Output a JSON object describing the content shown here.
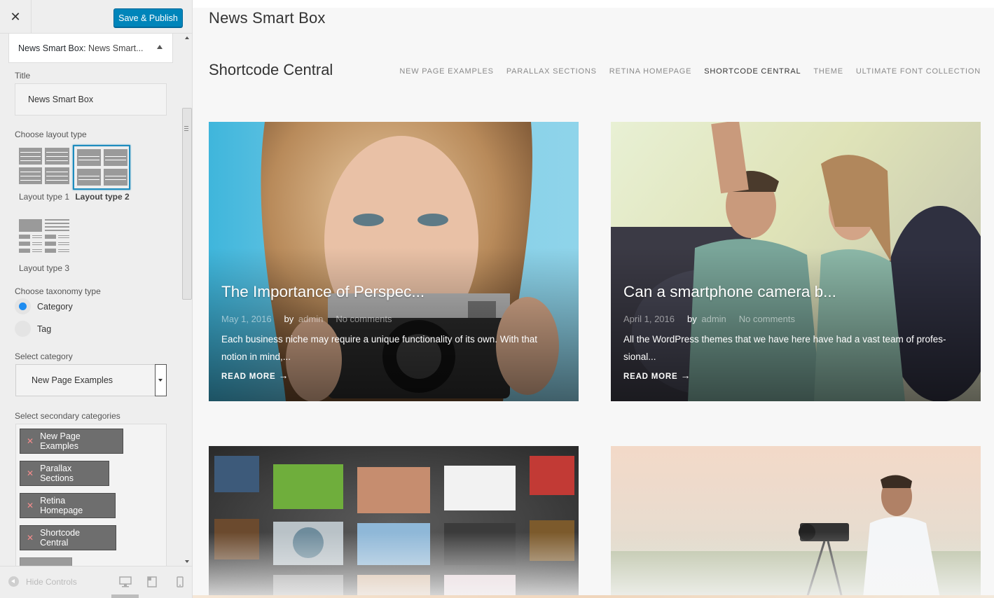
{
  "customizer": {
    "close_icon": "close-icon",
    "publish_label": "Save & Publish",
    "section_prefix": "News Smart Box:",
    "section_title": "News Smart...",
    "title_label": "Title",
    "title_value": "News Smart Box",
    "layout_label": "Choose layout type",
    "layouts": [
      {
        "label": "Layout type 1",
        "selected": false
      },
      {
        "label": "Layout type 2",
        "selected": true
      },
      {
        "label": "Layout type 3",
        "selected": false
      }
    ],
    "taxonomy_label": "Choose taxonomy type",
    "taxonomy_options": [
      {
        "label": "Category",
        "checked": true
      },
      {
        "label": "Tag",
        "checked": false
      }
    ],
    "category_label": "Select category",
    "category_value": "New Page Examples",
    "secondary_label": "Select secondary categories",
    "secondary_chips": [
      "New Page Examples",
      "Parallax Sections",
      "Retina Homepage",
      "Shortcode Central"
    ],
    "hide_controls": "Hide Controls",
    "devices": [
      "desktop-icon",
      "tablet-icon",
      "mobile-icon"
    ],
    "accent_color": "#0085ba"
  },
  "preview": {
    "widget_title": "News Smart Box",
    "site_title": "Shortcode Central",
    "nav": [
      {
        "label": "NEW PAGE EXAMPLES",
        "active": false
      },
      {
        "label": "PARALLAX SECTIONS",
        "active": false
      },
      {
        "label": "RETINA HOMEPAGE",
        "active": false
      },
      {
        "label": "SHORTCODE CENTRAL",
        "active": true
      },
      {
        "label": "THEME",
        "active": false
      },
      {
        "label": "ULTIMATE FONT COLLECTION",
        "active": false
      }
    ],
    "posts": [
      {
        "title": "The Importance of Perspec...",
        "date": "May 1, 2016",
        "by": "by",
        "author": "admin",
        "comments": "No comments",
        "excerpt": "Each business niche may require a unique functionality of its own. With that notion in mind,...",
        "more": "READ MORE"
      },
      {
        "title": "Can a smartphone camera b...",
        "date": "April 1, 2016",
        "by": "by",
        "author": "admin",
        "comments": "No comments",
        "excerpt": "All the WordPress themes that we have here have had a vast team of profes- sional...",
        "more": "READ MORE"
      }
    ]
  }
}
